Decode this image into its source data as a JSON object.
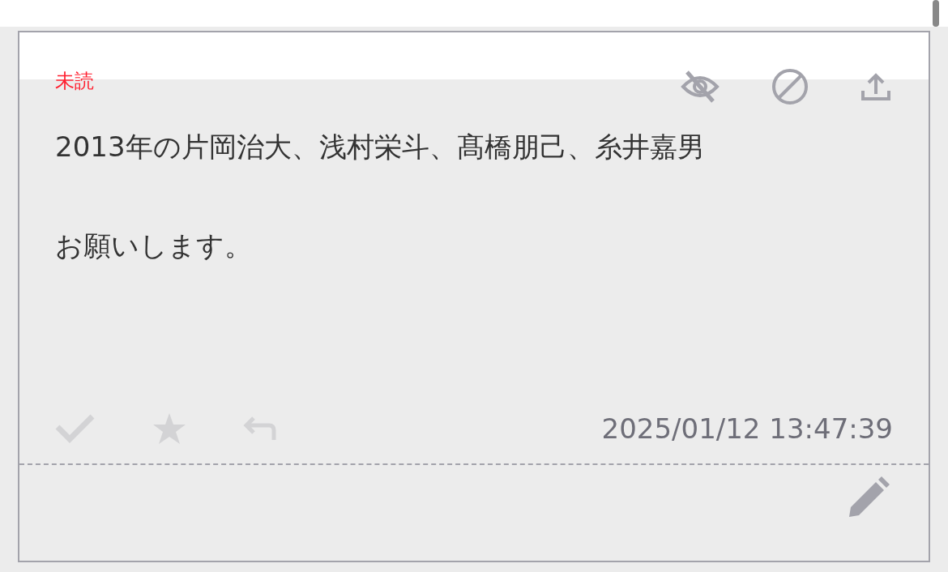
{
  "card": {
    "status": "未読",
    "message": [
      "2013年の片岡治大、浅村栄斗、髙橋朋己、糸井嘉男",
      "お願いします。"
    ],
    "timestamp": "2025/01/12 13:47:39"
  }
}
